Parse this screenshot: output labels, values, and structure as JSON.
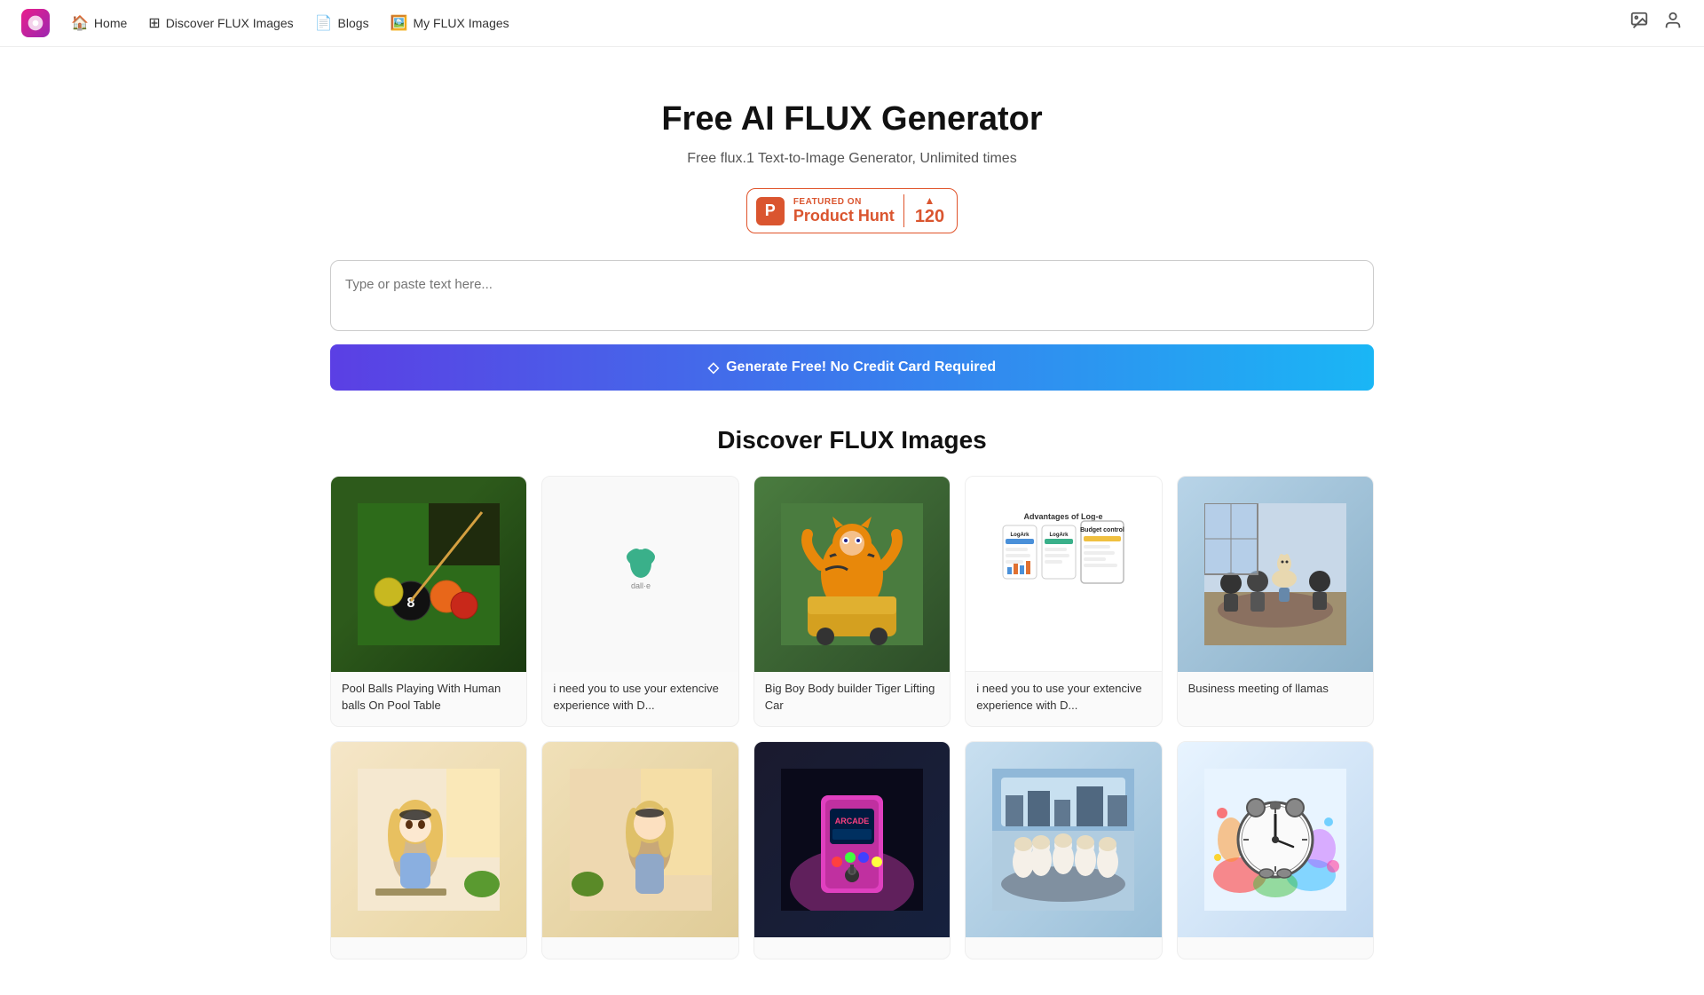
{
  "nav": {
    "logo_symbol": "🪁",
    "items": [
      {
        "id": "home",
        "icon": "🏠",
        "label": "Home"
      },
      {
        "id": "discover",
        "icon": "🔳",
        "label": "Discover FLUX Images"
      },
      {
        "id": "blogs",
        "icon": "📄",
        "label": "Blogs"
      },
      {
        "id": "myflux",
        "icon": "🖼️",
        "label": "My FLUX Images"
      }
    ],
    "right_icons": [
      {
        "id": "image-search",
        "icon": "🔍"
      },
      {
        "id": "user",
        "icon": "👤"
      }
    ]
  },
  "hero": {
    "title": "Free AI FLUX Generator",
    "subtitle": "Free flux.1 Text-to-Image Generator, Unlimited times",
    "product_hunt": {
      "featured_label": "FEATURED ON",
      "name": "Product Hunt",
      "count": "120"
    }
  },
  "generator": {
    "placeholder": "Type or paste text here...",
    "button_label": "Generate Free! No Credit Card Required",
    "button_icon": "◇"
  },
  "gallery": {
    "title": "Discover FLUX Images",
    "row1": [
      {
        "id": "pool-balls",
        "caption": "Pool Balls Playing With Human balls On Pool Table",
        "img_type": "pool"
      },
      {
        "id": "dalle-ext",
        "caption": "i need you to use your extencive experience with D...",
        "img_type": "dalle"
      },
      {
        "id": "tiger-lifting",
        "caption": "Big Boy Body builder Tiger Lifting Car",
        "img_type": "tiger"
      },
      {
        "id": "loge-adv",
        "caption": "i need you to use your extencive experience with D...",
        "img_type": "loge"
      },
      {
        "id": "llama-meeting",
        "caption": "Business meeting of llamas",
        "img_type": "llama"
      }
    ],
    "row2": [
      {
        "id": "anime-girl1",
        "caption": "",
        "img_type": "anime1"
      },
      {
        "id": "anime-girl2",
        "caption": "",
        "img_type": "anime2"
      },
      {
        "id": "arcade-machine",
        "caption": "",
        "img_type": "arcade"
      },
      {
        "id": "arabic-meeting",
        "caption": "",
        "img_type": "arabic"
      },
      {
        "id": "clock-splash",
        "caption": "",
        "img_type": "clock"
      }
    ]
  }
}
